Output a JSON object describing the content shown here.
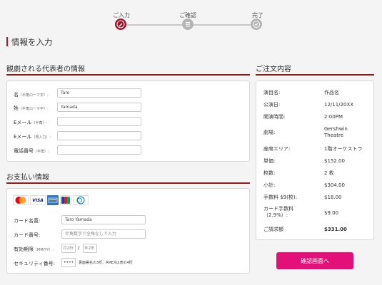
{
  "stepper": {
    "steps": [
      {
        "label": "ご入力",
        "state": "active"
      },
      {
        "label": "ご確認",
        "state": "inactive"
      },
      {
        "label": "完了",
        "state": "inactive"
      }
    ]
  },
  "page_title": "情報を入力",
  "representative": {
    "heading": "観劇される代表者の情報",
    "fields": [
      {
        "label": "名",
        "note": "（半角ローマ字）:",
        "value": "Taro",
        "placeholder": ""
      },
      {
        "label": "姓",
        "note": "（半角ローマ字）:",
        "value": "Yamada",
        "placeholder": ""
      },
      {
        "label": "Eメール",
        "note": "（半角）:",
        "value": "",
        "placeholder": ""
      },
      {
        "label": "Eメール",
        "note": "（再入力）:",
        "value": "",
        "placeholder": ""
      },
      {
        "label": "電話番号",
        "note": "（半角）:",
        "value": "",
        "placeholder": ""
      }
    ]
  },
  "payment": {
    "heading": "お支払い情報",
    "cards": [
      "MasterCard",
      "VISA",
      "AMEX",
      "JCB",
      "Diners Club"
    ],
    "card_name_label": "カード名義:",
    "card_name_value": "Taro Yamada",
    "card_number_label": "カード番号:",
    "card_number_placeholder": "半角数字で全角なしで入力",
    "expiry_label": "有効期限",
    "expiry_note": "（MM/YY）:",
    "expiry_month_placeholder": "月2桁",
    "expiry_sep": "/",
    "expiry_year_placeholder": "年2桁",
    "security_label": "セキュリティ番号:",
    "security_value": "••••",
    "security_hint": "裏面署名の3桁、AMEXは表の4桁"
  },
  "order": {
    "heading": "ご注文内容",
    "rows": [
      {
        "key": "演目名:",
        "value": "作品名"
      },
      {
        "key": "公演日:",
        "value": "12/11/20XX"
      },
      {
        "key": "開演時間:",
        "value": "2:00PM"
      },
      {
        "key": "劇場:",
        "value": "Gershwin\nTheatre"
      },
      {
        "key": "座席エリア:",
        "value": "1階オーケストラ"
      },
      {
        "key": "単価:",
        "value": "$152.00"
      },
      {
        "key": "枚数:",
        "value": "2 枚"
      },
      {
        "key": "小計:",
        "value": "$304.00"
      },
      {
        "key": "手数料 $9(枚):",
        "value": "$18.00"
      },
      {
        "key": "カード手数料\n（2.9%）:",
        "value": "$9.00"
      },
      {
        "key": "ご請求額",
        "value": "$331.00"
      }
    ]
  },
  "confirm_button": "確認画面へ",
  "colors": {
    "accent": "#b8132a",
    "button": "#e4107a",
    "rule": "#8e1a1a"
  }
}
